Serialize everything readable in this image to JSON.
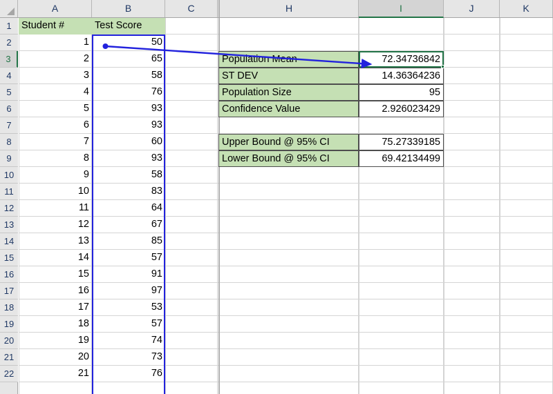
{
  "app": {
    "type": "spreadsheet",
    "select_all_corner": "select-all"
  },
  "columns": [
    {
      "label": "A",
      "selected": false,
      "hidden_before": false
    },
    {
      "label": "B",
      "selected": false,
      "hidden_before": false
    },
    {
      "label": "C",
      "selected": false,
      "hidden_before": false
    },
    {
      "label": "H",
      "selected": false,
      "hidden_before": true
    },
    {
      "label": "I",
      "selected": true,
      "hidden_before": false
    },
    {
      "label": "J",
      "selected": false,
      "hidden_before": false
    },
    {
      "label": "K",
      "selected": false,
      "hidden_before": false
    }
  ],
  "rows": [
    {
      "label": "1",
      "selected": false
    },
    {
      "label": "2",
      "selected": false
    },
    {
      "label": "3",
      "selected": true
    },
    {
      "label": "4",
      "selected": false
    },
    {
      "label": "5",
      "selected": false
    },
    {
      "label": "6",
      "selected": false
    },
    {
      "label": "7",
      "selected": false
    },
    {
      "label": "8",
      "selected": false
    },
    {
      "label": "9",
      "selected": false
    },
    {
      "label": "10",
      "selected": false
    },
    {
      "label": "11",
      "selected": false
    },
    {
      "label": "12",
      "selected": false
    },
    {
      "label": "13",
      "selected": false
    },
    {
      "label": "14",
      "selected": false
    },
    {
      "label": "15",
      "selected": false
    },
    {
      "label": "16",
      "selected": false
    },
    {
      "label": "17",
      "selected": false
    },
    {
      "label": "18",
      "selected": false
    },
    {
      "label": "19",
      "selected": false
    },
    {
      "label": "20",
      "selected": false
    },
    {
      "label": "21",
      "selected": false
    },
    {
      "label": "22",
      "selected": false
    }
  ],
  "table_headers": {
    "student": "Student #",
    "score": "Test Score"
  },
  "data_table": {
    "student_numbers": [
      "1",
      "2",
      "3",
      "4",
      "5",
      "6",
      "7",
      "8",
      "9",
      "10",
      "11",
      "12",
      "13",
      "14",
      "15",
      "16",
      "17",
      "18",
      "19",
      "20",
      "21"
    ],
    "test_scores": [
      "50",
      "65",
      "58",
      "76",
      "93",
      "93",
      "60",
      "93",
      "58",
      "83",
      "64",
      "67",
      "85",
      "57",
      "91",
      "97",
      "53",
      "57",
      "74",
      "73",
      "76"
    ]
  },
  "stats_panel": {
    "rows": [
      {
        "label": "Population Mean",
        "value": "72.34736842"
      },
      {
        "label": "ST DEV",
        "value": "14.36364236"
      },
      {
        "label": "Population Size",
        "value": "95"
      },
      {
        "label": "Confidence Value",
        "value": "2.926023429"
      }
    ]
  },
  "bounds_panel": {
    "rows": [
      {
        "label": "Upper Bound @ 95% CI",
        "value": "75.27339185"
      },
      {
        "label": "Lower Bound @ 95% CI",
        "value": "69.42134499"
      }
    ]
  },
  "annotation": {
    "type": "arrow",
    "color": "#2222dd",
    "from_label": "test-score-column",
    "to_label": "population-mean-cell"
  },
  "selection": {
    "active_cell": "I3",
    "active_cell_color": "#217346",
    "range_color": "#2222dd",
    "range": "B2:B22+"
  },
  "colors": {
    "header_fill": "#c5e0b4",
    "grid_line": "#d4d4d4",
    "header_bar": "#e6e6e6"
  }
}
